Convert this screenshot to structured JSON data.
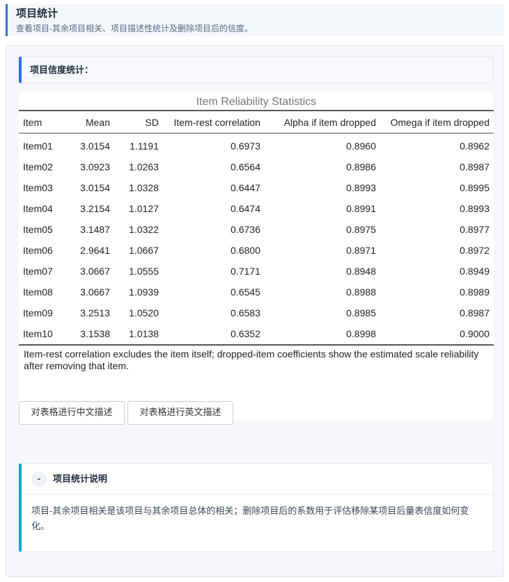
{
  "header": {
    "title": "项目统计",
    "subtitle": "查看项目-其余项目相关、项目描述性统计及删除项目后的信度。"
  },
  "section": {
    "label": "项目信度统计："
  },
  "table": {
    "title": "Item Reliability Statistics",
    "columns": [
      "Item",
      "Mean",
      "SD",
      "Item-rest correlation",
      "Alpha if item dropped",
      "Omega if item dropped"
    ],
    "rows": [
      [
        "Item01",
        "3.0154",
        "1.1191",
        "0.6973",
        "0.8960",
        "0.8962"
      ],
      [
        "Item02",
        "3.0923",
        "1.0263",
        "0.6564",
        "0.8986",
        "0.8987"
      ],
      [
        "Item03",
        "3.0154",
        "1.0328",
        "0.6447",
        "0.8993",
        "0.8995"
      ],
      [
        "Item04",
        "3.2154",
        "1.0127",
        "0.6474",
        "0.8991",
        "0.8993"
      ],
      [
        "Item05",
        "3.1487",
        "1.0322",
        "0.6736",
        "0.8975",
        "0.8977"
      ],
      [
        "Item06",
        "2.9641",
        "1.0667",
        "0.6800",
        "0.8971",
        "0.8972"
      ],
      [
        "Item07",
        "3.0667",
        "1.0555",
        "0.7171",
        "0.8948",
        "0.8949"
      ],
      [
        "Item08",
        "3.0667",
        "1.0939",
        "0.6545",
        "0.8988",
        "0.8989"
      ],
      [
        "Item09",
        "3.2513",
        "1.0520",
        "0.6583",
        "0.8985",
        "0.8987"
      ],
      [
        "Item10",
        "3.1538",
        "1.0138",
        "0.6352",
        "0.8998",
        "0.9000"
      ]
    ],
    "note": "Item-rest correlation excludes the item itself; dropped-item coefficients show the estimated scale reliability after removing that item."
  },
  "buttons": {
    "describe_zh": "对表格进行中文描述",
    "describe_en": "对表格进行英文描述"
  },
  "info": {
    "toggle": "-",
    "title": "项目统计说明",
    "body": "项目-其余项目相关是该项目与其余项目总体的相关；删除项目后的系数用于评估移除某项目后量表信度如何变化。"
  },
  "colors": {
    "accent": "#2f6fe0",
    "info_accent": "#1aa3d9"
  }
}
